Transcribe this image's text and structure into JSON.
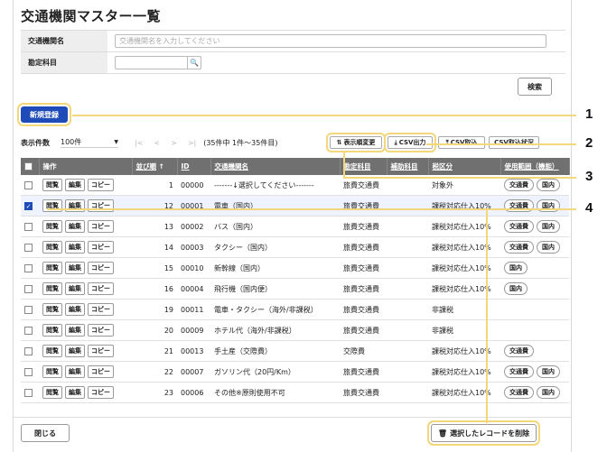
{
  "page_title": "交通機関マスター一覧",
  "search": {
    "name_label": "交通機関名",
    "name_placeholder": "交通機関名を入力してください",
    "subject_label": "勘定科目",
    "search_button": "検索"
  },
  "new_button": "新規登録",
  "toolbar": {
    "count_label": "表示件数",
    "count_value": "100件",
    "first": "|<",
    "prev": "<",
    "next": ">",
    "last": ">|",
    "range": "(35件中 1件〜35件目)",
    "sort_change": "表示順変更",
    "csv_export": "CSV出力",
    "csv_import": "CSV取込",
    "csv_status": "CSV取込状況"
  },
  "columns": {
    "operation": "操作",
    "order": "並び順",
    "id": "ID",
    "name": "交通機関名",
    "subject": "勘定科目",
    "sub_subject": "補助科目",
    "tax": "税区分",
    "scope": "使用範囲（機能）"
  },
  "row_buttons": {
    "view": "閲覧",
    "edit": "編集",
    "copy": "コピー"
  },
  "rows": [
    {
      "checked": false,
      "order": "1",
      "id": "00000",
      "name": "-------↓選択してください-------",
      "subject": "旅費交通費",
      "sub": "",
      "tax": "対象外",
      "scope": [
        "交通費",
        "国内"
      ]
    },
    {
      "checked": true,
      "order": "12",
      "id": "00001",
      "name": "電車（国内）",
      "subject": "旅費交通費",
      "sub": "",
      "tax": "課税対応仕入10%",
      "scope": [
        "交通費",
        "国内"
      ]
    },
    {
      "checked": false,
      "order": "13",
      "id": "00002",
      "name": "バス（国内）",
      "subject": "旅費交通費",
      "sub": "",
      "tax": "課税対応仕入10%",
      "scope": [
        "交通費",
        "国内"
      ]
    },
    {
      "checked": false,
      "order": "14",
      "id": "00003",
      "name": "タクシー（国内）",
      "subject": "旅費交通費",
      "sub": "",
      "tax": "課税対応仕入10%",
      "scope": [
        "交通費",
        "国内"
      ]
    },
    {
      "checked": false,
      "order": "15",
      "id": "00010",
      "name": "新幹線（国内）",
      "subject": "旅費交通費",
      "sub": "",
      "tax": "課税対応仕入10%",
      "scope": [
        "国内"
      ]
    },
    {
      "checked": false,
      "order": "16",
      "id": "00004",
      "name": "飛行機（国内便）",
      "subject": "旅費交通費",
      "sub": "",
      "tax": "課税対応仕入10%",
      "scope": [
        "国内"
      ]
    },
    {
      "checked": false,
      "order": "19",
      "id": "00011",
      "name": "電車・タクシー（海外/非課税）",
      "subject": "旅費交通費",
      "sub": "",
      "tax": "非課税",
      "scope": []
    },
    {
      "checked": false,
      "order": "20",
      "id": "00009",
      "name": "ホテル代（海外/非課税）",
      "subject": "旅費交通費",
      "sub": "",
      "tax": "非課税",
      "scope": []
    },
    {
      "checked": false,
      "order": "21",
      "id": "00013",
      "name": "手土産（交際費）",
      "subject": "交際費",
      "sub": "",
      "tax": "課税対応仕入10%",
      "scope": [
        "交通費"
      ]
    },
    {
      "checked": false,
      "order": "22",
      "id": "00007",
      "name": "ガソリン代（20円/Km）",
      "subject": "旅費交通費",
      "sub": "",
      "tax": "課税対応仕入10%",
      "scope": [
        "交通費",
        "国内"
      ]
    },
    {
      "checked": false,
      "order": "23",
      "id": "00006",
      "name": "その他※原則使用不可",
      "subject": "旅費交通費",
      "sub": "",
      "tax": "課税対応仕入10%",
      "scope": [
        "交通費",
        "国内"
      ]
    }
  ],
  "footer": {
    "close_button": "閉じる",
    "delete_button": "選択したレコードを削除"
  },
  "callouts": [
    "1",
    "2",
    "3",
    "4"
  ],
  "colors": {
    "primary": "#1f4bb8",
    "header_bg": "#707070",
    "highlight": "#f3d77a"
  }
}
